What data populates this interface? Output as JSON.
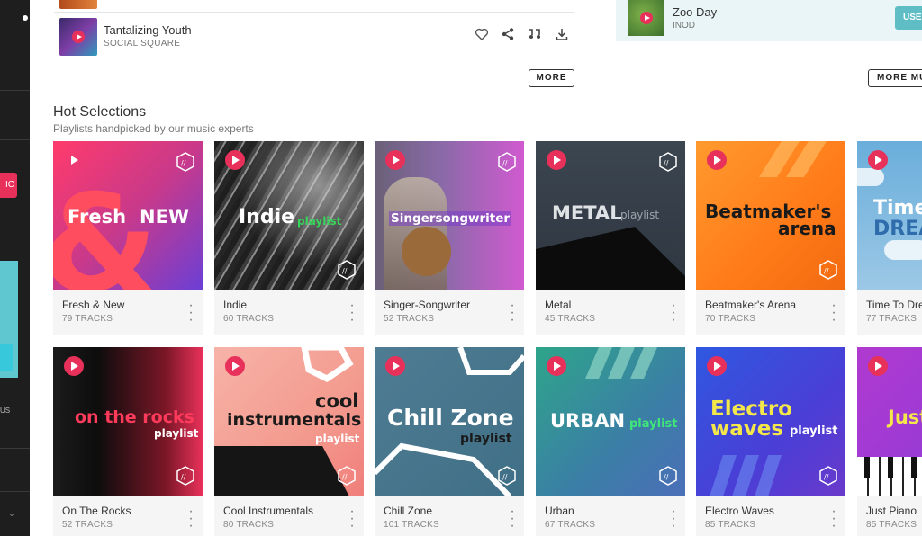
{
  "top_track": {
    "title": "Tantalizing Youth",
    "artist": "SOCIAL SQUARE"
  },
  "right_track": {
    "title": "Zoo Day",
    "artist": "INOD",
    "use_label": "USE"
  },
  "more_label": "MORE",
  "more_music_label": "MORE MU",
  "section": {
    "title": "Hot Selections",
    "subtitle": "Playlists handpicked by our music experts"
  },
  "sidebar": {
    "red_label": "IC",
    "small_text": "US"
  },
  "cards_row1": [
    {
      "name": "Fresh & New",
      "count": "79 TRACKS",
      "art_main": "Fresh",
      "art_amp": "&",
      "art_accent": "NEW"
    },
    {
      "name": "Indie",
      "count": "60 TRACKS",
      "art_main": "Indie",
      "art_accent": "playlist"
    },
    {
      "name": "Singer-Songwriter",
      "count": "52 TRACKS",
      "art_main": "Singersongwriter"
    },
    {
      "name": "Metal",
      "count": "45 TRACKS",
      "art_main": "METAL",
      "art_accent": "playlist"
    },
    {
      "name": "Beatmaker's Arena",
      "count": "70 TRACKS",
      "art_main": "Beatmaker's",
      "art_line2": "arena"
    },
    {
      "name": "Time To Drea",
      "count": "77 TRACKS",
      "art_main": "Time",
      "art_line2": "DREA"
    }
  ],
  "cards_row2": [
    {
      "name": "On The Rocks",
      "count": "52 TRACKS",
      "art_main": "on the rocks",
      "art_accent": "playlist"
    },
    {
      "name": "Cool Instrumentals",
      "count": "80 TRACKS",
      "art_main": "cool",
      "art_line2": "instrumentals",
      "art_accent": "playlist"
    },
    {
      "name": "Chill Zone",
      "count": "101 TRACKS",
      "art_main": "Chill Zone",
      "art_accent": "playlist"
    },
    {
      "name": "Urban",
      "count": "67 TRACKS",
      "art_main": "URBAN",
      "art_accent": "playlist"
    },
    {
      "name": "Electro Waves",
      "count": "85 TRACKS",
      "art_main": "Electro",
      "art_line2": "waves",
      "art_accent": "playlist"
    },
    {
      "name": "Just Piano",
      "count": "85 TRACKS",
      "art_main": "Just"
    }
  ],
  "colors": {
    "accent": "#e8315a",
    "teal": "#5fbdc6",
    "sidebar": "#1e1e1e"
  }
}
